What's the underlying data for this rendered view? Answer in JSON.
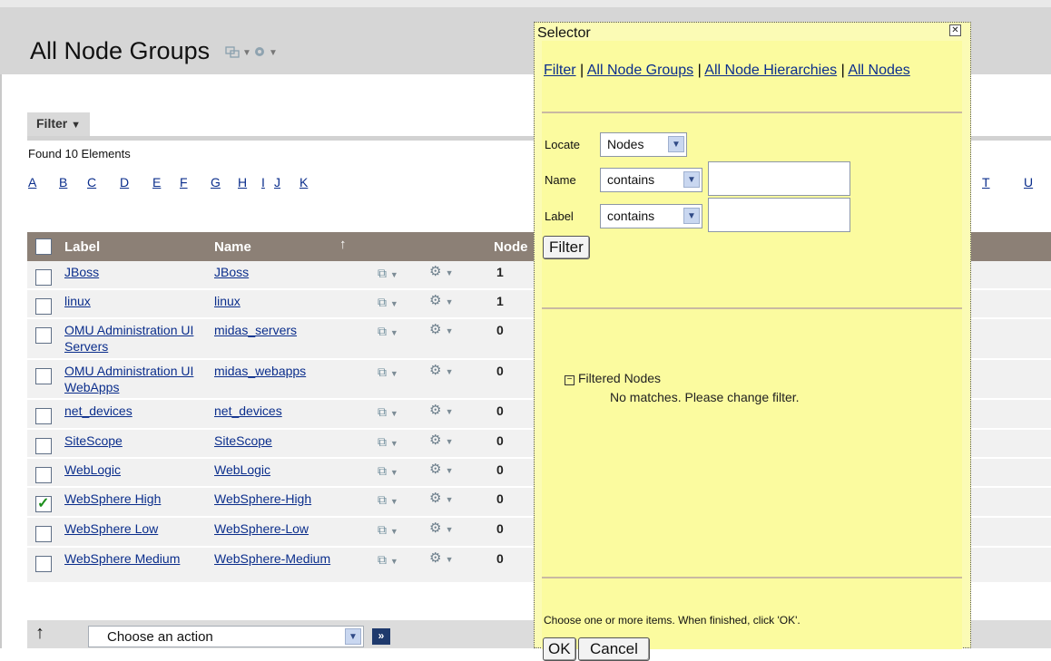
{
  "page": {
    "title": "All Node Groups",
    "filter_tab": "Filter",
    "found_text": "Found 10 Elements",
    "alphabet": [
      "A",
      "B",
      "C",
      "D",
      "E",
      "F",
      "G",
      "H",
      "I",
      "J",
      "K",
      "T",
      "U"
    ]
  },
  "table": {
    "columns": [
      "Label",
      "Name",
      "Node"
    ],
    "rows": [
      {
        "label": "JBoss",
        "name": "JBoss",
        "count": "1",
        "checked": false
      },
      {
        "label": "linux",
        "name": "linux",
        "count": "1",
        "checked": false
      },
      {
        "label": "OMU Administration UI Servers",
        "name": "midas_servers",
        "count": "0",
        "checked": false
      },
      {
        "label": "OMU Administration UI WebApps",
        "name": "midas_webapps",
        "count": "0",
        "checked": false
      },
      {
        "label": "net_devices",
        "name": "net_devices",
        "count": "0",
        "checked": false
      },
      {
        "label": "SiteScope",
        "name": "SiteScope",
        "count": "0",
        "checked": false
      },
      {
        "label": "WebLogic",
        "name": "WebLogic",
        "count": "0",
        "checked": false
      },
      {
        "label": "WebSphere High",
        "name": "WebSphere-High",
        "count": "0",
        "checked": true
      },
      {
        "label": "WebSphere Low",
        "name": "WebSphere-Low",
        "count": "0",
        "checked": false
      },
      {
        "label": "WebSphere Medium",
        "name": "WebSphere-Medium",
        "count": "0",
        "checked": false
      }
    ]
  },
  "footer": {
    "action_select": "Choose an action"
  },
  "selector": {
    "title": "Selector",
    "links": [
      "Filter",
      "All Node Groups",
      "All Node Hierarchies",
      "All Nodes"
    ],
    "locate_label": "Locate",
    "locate_value": "Nodes",
    "name_label": "Name",
    "name_op": "contains",
    "label_label": "Label",
    "label_op": "contains",
    "filter_button": "Filter",
    "filtered_title": "Filtered Nodes",
    "no_match": "No matches. Please change filter.",
    "hint": "Choose one or more items. When finished, click 'OK'.",
    "ok_button": "OK",
    "cancel_button": "Cancel"
  },
  "colors": {
    "table_header": "#8c8076",
    "selector_bg": "#fbfb9f",
    "link": "#0b2e8c"
  }
}
